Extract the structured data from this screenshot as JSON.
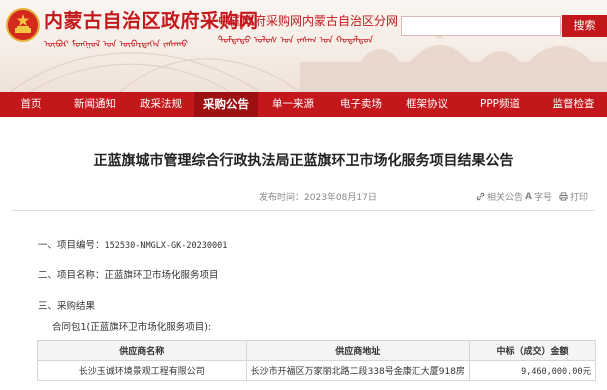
{
  "header": {
    "site_name": "内蒙古自治区政府采购网",
    "site_sub": "中国政府采购网内蒙古自治区分网",
    "mongol_line1": "ᠦᠪᠦᠷ ᠮᠣᠩᠭᠣᠯ ᠤᠨ ᠥᠪᠡᠷᠲᠡᠭᠡᠨ ᠵᠠᠰᠠᠬᠤ",
    "mongol_line2": "ᠳᠤᠮᠳᠠᠳᠤ ᠣᠯᠣᠰ ᠤᠨ ᠵᠠᠰᠠᠭ ᠤᠨ ᠬᠤᠳᠠᠯᠳᠤᠨ",
    "search_placeholder": "",
    "search_button": "搜索"
  },
  "nav": {
    "items": [
      "首页",
      "新闻通知",
      "政采法规",
      "采购公告",
      "单一来源",
      "电子卖场",
      "框架协议",
      "PPP频道",
      "监督检查"
    ],
    "active_index": 3
  },
  "article": {
    "title": "正蓝旗城市管理综合行政执法局正蓝旗环卫市场化服务项目结果公告",
    "publish_label": "发布时间：",
    "publish_date": "2023年08月17日",
    "tools": {
      "related": "相关公告",
      "font": "字号",
      "print": "打印"
    },
    "sections": {
      "s1_label": "一、项目编号：",
      "s1_value": "152530-NMGLX-GK-20230001",
      "s2_label": "二、项目名称：",
      "s2_value": "正蓝旗环卫市场化服务项目",
      "s3_label": "三、采购结果",
      "package_label": "合同包1(正蓝旗环卫市场化服务项目):"
    },
    "table": {
      "headers": [
        "供应商名称",
        "供应商地址",
        "中标（成交）金额"
      ],
      "rows": [
        [
          "长沙玉诚环境景观工程有限公司",
          "长沙市开福区万家丽北路二段338号金康汇大厦918房",
          "9,460,000.00元"
        ]
      ]
    }
  },
  "colors": {
    "brand_red": "#c4171b",
    "nav_active": "#9e0f12"
  }
}
